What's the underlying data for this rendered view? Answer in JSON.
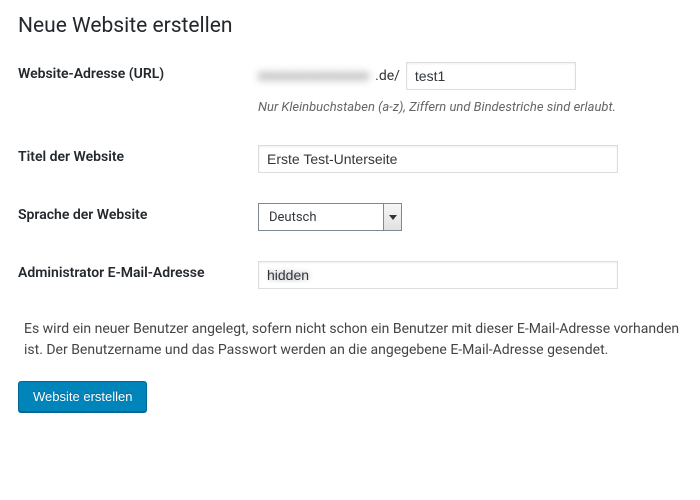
{
  "header": {
    "title": "Neue Website erstellen"
  },
  "fields": {
    "url": {
      "label": "Website-Adresse (URL)",
      "domain_obscured": "xxxxxxxxxxxxxxxx",
      "domain_suffix": ".de/",
      "slug_value": "test1",
      "hint": "Nur Kleinbuchstaben (a-z), Ziffern und Bindestriche sind erlaubt."
    },
    "title": {
      "label": "Titel der Website",
      "value": "Erste Test-Unterseite"
    },
    "language": {
      "label": "Sprache der Website",
      "selected": "Deutsch"
    },
    "admin_email": {
      "label": "Administrator E-Mail-Adresse",
      "value": "hidden"
    }
  },
  "notice": "Es wird ein neuer Benutzer angelegt, sofern nicht schon ein Benutzer mit dieser E-Mail-Adresse vorhanden ist. Der Benutzername und das Passwort werden an die angegebene E-Mail-Adresse gesendet.",
  "actions": {
    "submit_label": "Website erstellen"
  }
}
